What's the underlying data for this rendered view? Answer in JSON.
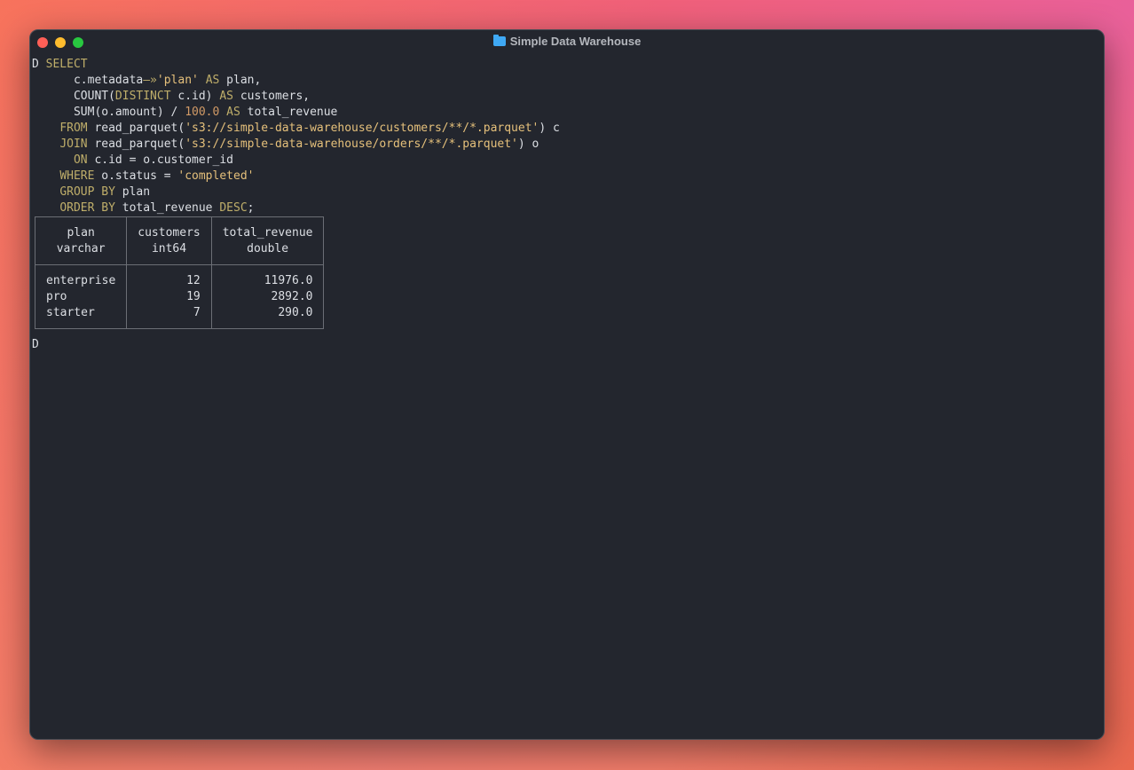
{
  "window": {
    "title": "Simple Data Warehouse"
  },
  "terminal": {
    "prompt": "D",
    "query_lines": [
      [
        {
          "t": "D ",
          "c": "plain"
        },
        {
          "t": "SELECT",
          "c": "kw"
        }
      ],
      [
        {
          "t": "      c.metadata",
          "c": "plain"
        },
        {
          "t": "—»",
          "c": "kw"
        },
        {
          "t": "'plan'",
          "c": "str"
        },
        {
          "t": " ",
          "c": "plain"
        },
        {
          "t": "AS",
          "c": "kw"
        },
        {
          "t": " plan,",
          "c": "plain"
        }
      ],
      [
        {
          "t": "      COUNT(",
          "c": "plain"
        },
        {
          "t": "DISTINCT",
          "c": "kw"
        },
        {
          "t": " c.id) ",
          "c": "plain"
        },
        {
          "t": "AS",
          "c": "kw"
        },
        {
          "t": " customers,",
          "c": "plain"
        }
      ],
      [
        {
          "t": "      SUM(o.amount) / ",
          "c": "plain"
        },
        {
          "t": "100.0",
          "c": "num"
        },
        {
          "t": " ",
          "c": "plain"
        },
        {
          "t": "AS",
          "c": "kw"
        },
        {
          "t": " total_revenue",
          "c": "plain"
        }
      ],
      [
        {
          "t": "    ",
          "c": "plain"
        },
        {
          "t": "FROM",
          "c": "kw"
        },
        {
          "t": " read_parquet(",
          "c": "plain"
        },
        {
          "t": "'s3://simple-data-warehouse/customers/**/*.parquet'",
          "c": "str"
        },
        {
          "t": ") c",
          "c": "plain"
        }
      ],
      [
        {
          "t": "    ",
          "c": "plain"
        },
        {
          "t": "JOIN",
          "c": "kw"
        },
        {
          "t": " read_parquet(",
          "c": "plain"
        },
        {
          "t": "'s3://simple-data-warehouse/orders/**/*.parquet'",
          "c": "str"
        },
        {
          "t": ") o",
          "c": "plain"
        }
      ],
      [
        {
          "t": "      ",
          "c": "plain"
        },
        {
          "t": "ON",
          "c": "kw"
        },
        {
          "t": " c.id = o.customer_id",
          "c": "plain"
        }
      ],
      [
        {
          "t": "    ",
          "c": "plain"
        },
        {
          "t": "WHERE",
          "c": "kw"
        },
        {
          "t": " o.status = ",
          "c": "plain"
        },
        {
          "t": "'completed'",
          "c": "str"
        }
      ],
      [
        {
          "t": "    ",
          "c": "plain"
        },
        {
          "t": "GROUP BY",
          "c": "kw"
        },
        {
          "t": " plan",
          "c": "plain"
        }
      ],
      [
        {
          "t": "    ",
          "c": "plain"
        },
        {
          "t": "ORDER BY",
          "c": "kw"
        },
        {
          "t": " total_revenue ",
          "c": "plain"
        },
        {
          "t": "DESC",
          "c": "kw"
        },
        {
          "t": ";",
          "c": "plain"
        }
      ]
    ],
    "result": {
      "columns": [
        {
          "name": "plan",
          "type": "varchar",
          "align": "left"
        },
        {
          "name": "customers",
          "type": "int64",
          "align": "right"
        },
        {
          "name": "total_revenue",
          "type": "double",
          "align": "right"
        }
      ],
      "rows": [
        [
          "enterprise",
          "12",
          "11976.0"
        ],
        [
          "pro",
          "19",
          "2892.0"
        ],
        [
          "starter",
          "7",
          "290.0"
        ]
      ]
    },
    "next_prompt": "D"
  },
  "colors": {
    "keyword": "#bfae6a",
    "string": "#e5c07b",
    "number": "#d19a66",
    "text": "#dcdfe4",
    "background": "#23262e"
  }
}
